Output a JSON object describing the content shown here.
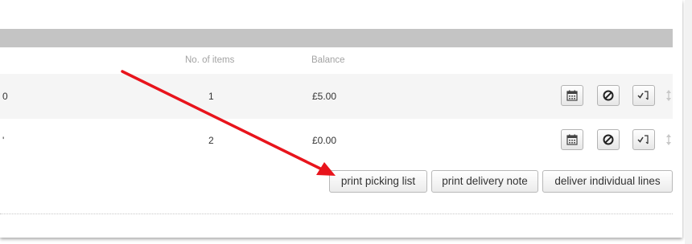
{
  "table": {
    "columns": {
      "no_of_items": "No. of items",
      "balance": "Balance"
    },
    "rows": [
      {
        "edge_text": "0",
        "no_of_items": "1",
        "balance": "£5.00"
      },
      {
        "edge_text": "'",
        "no_of_items": "2",
        "balance": "£0.00"
      }
    ],
    "row_action_icons": [
      "calendar-icon",
      "cancel-icon",
      "checklist-icon",
      "drag-handle-icon"
    ]
  },
  "actions": {
    "print_picking_list": "print picking list",
    "print_delivery_note": "print delivery note",
    "deliver_individual_lines": "deliver individual lines"
  },
  "annotation": {
    "arrow_color": "#e8141c",
    "points_to": "print picking list"
  },
  "colors": {
    "header_bar": "#c4c4c4",
    "striped_row": "#f5f5f5",
    "muted_header_text": "#a3a3a3"
  }
}
